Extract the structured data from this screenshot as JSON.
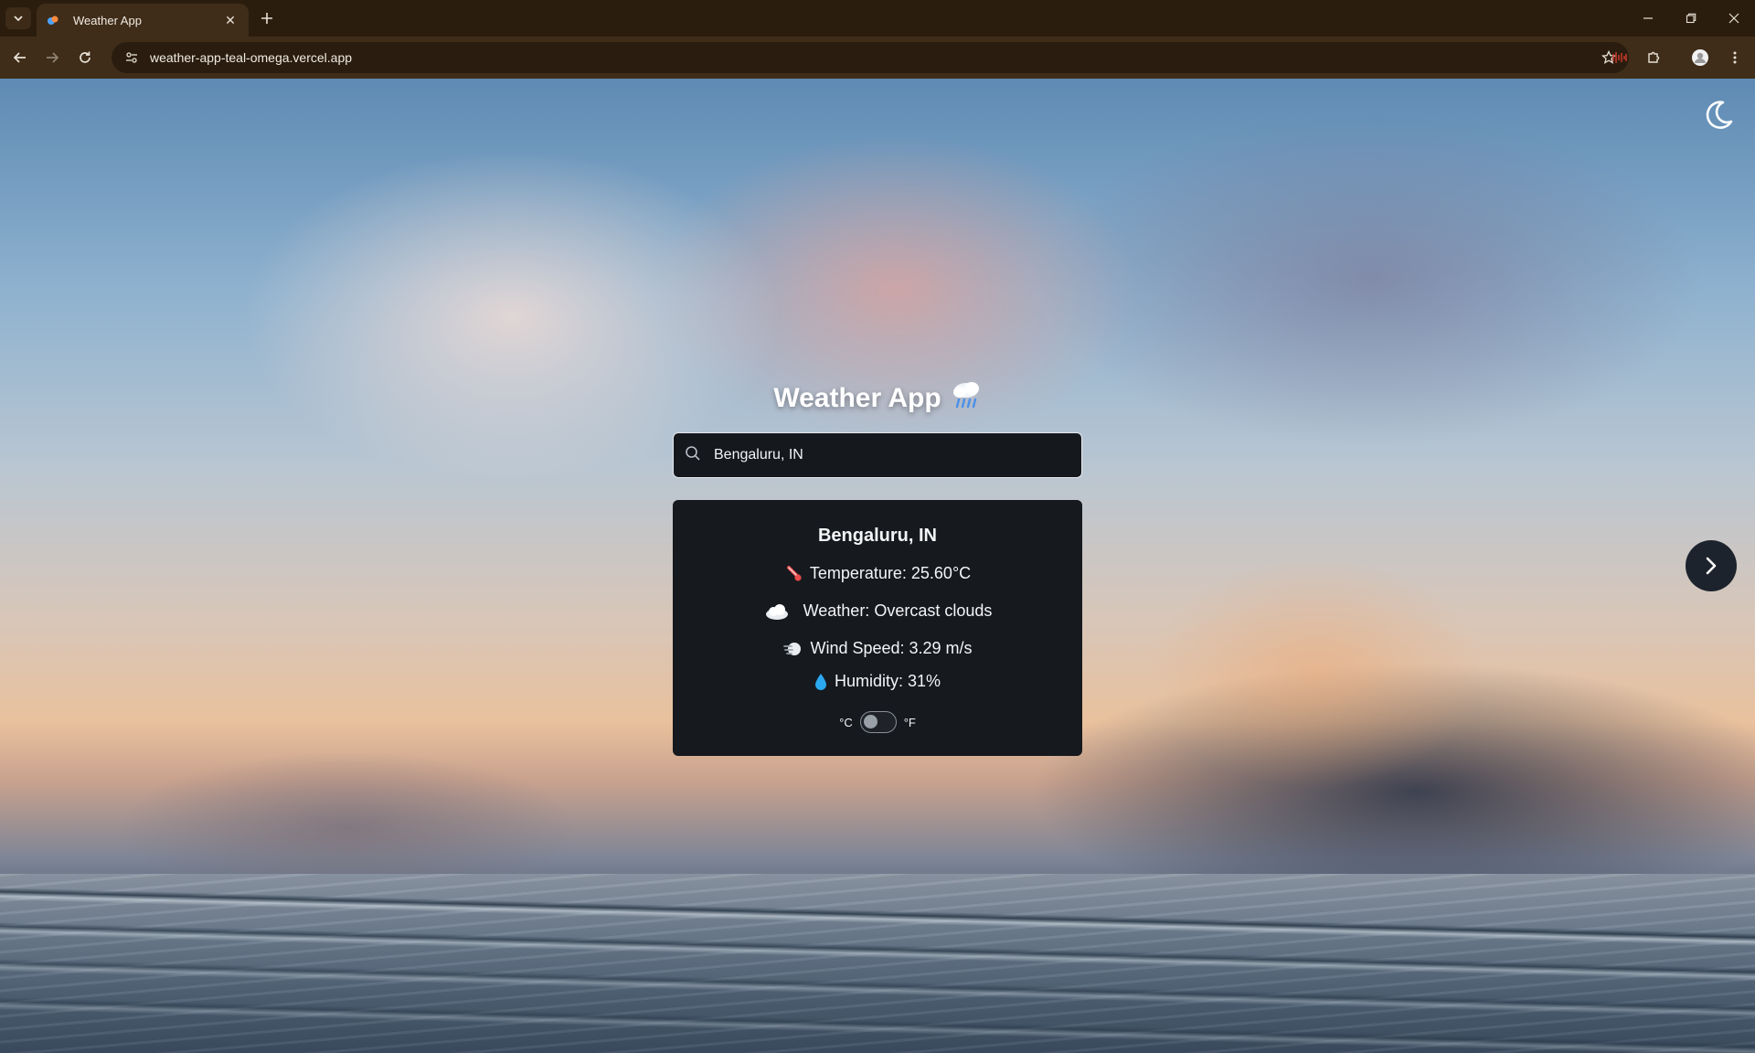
{
  "browser": {
    "tab_title": "Weather App",
    "url": "weather-app-teal-omega.vercel.app"
  },
  "app": {
    "title": "Weather App",
    "title_emoji": "🌧️",
    "search": {
      "value": "Bengaluru, IN",
      "placeholder": ""
    },
    "weather": {
      "city": "Bengaluru, IN",
      "temperature_label": "Temperature: 25.60°C",
      "weather_label": "Weather: Overcast clouds",
      "wind_label": "Wind Speed: 3.29 m/s",
      "humidity_label": "Humidity: 31%"
    },
    "unit_toggle": {
      "left_label": "°C",
      "right_label": "°F",
      "selected": "°C"
    }
  },
  "icons": {
    "theme_toggle": "moon-icon",
    "next": "chevron-right-icon",
    "search": "search-icon",
    "temperature": "thermometer-icon",
    "weather": "cloud-icon",
    "wind": "wind-icon",
    "humidity": "droplet-icon"
  }
}
